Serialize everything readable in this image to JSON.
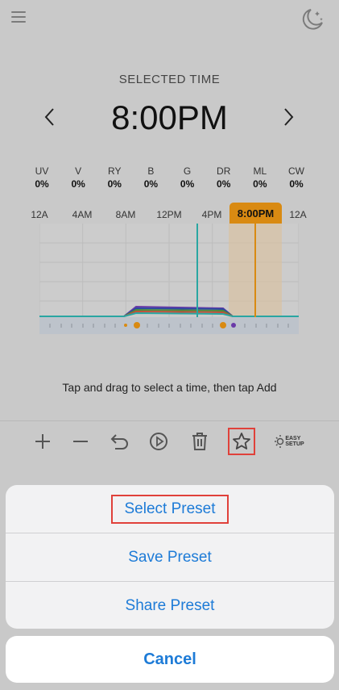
{
  "header": {
    "menu_icon": "hamburger-menu-icon",
    "moon_icon": "moon-stars-icon"
  },
  "schedule": {
    "selected_label": "SELECTED TIME",
    "time": "8:00PM",
    "prev_icon": "chevron-left-icon",
    "next_icon": "chevron-right-icon"
  },
  "channels": [
    {
      "name": "UV",
      "value": "0%"
    },
    {
      "name": "V",
      "value": "0%"
    },
    {
      "name": "RY",
      "value": "0%"
    },
    {
      "name": "B",
      "value": "0%"
    },
    {
      "name": "G",
      "value": "0%"
    },
    {
      "name": "DR",
      "value": "0%"
    },
    {
      "name": "ML",
      "value": "0%"
    },
    {
      "name": "CW",
      "value": "0%"
    }
  ],
  "timeline": {
    "labels": [
      "12A",
      "4AM",
      "8AM",
      "12PM",
      "4PM",
      "12A"
    ],
    "selected": "8:00PM"
  },
  "hint": "Tap and drag to select a time, then tap Add",
  "toolbar": {
    "icons": [
      "plus-icon",
      "minus-icon",
      "undo-icon",
      "play-icon",
      "trash-icon",
      "star-icon",
      "easy-setup-icon"
    ],
    "easy_setup_line1": "EASY",
    "easy_setup_line2": "SETUP"
  },
  "action_sheet": {
    "items": [
      "Select Preset",
      "Save Preset",
      "Share Preset"
    ],
    "cancel": "Cancel"
  },
  "colors": {
    "accent": "#d98a12",
    "link": "#1d7bd7",
    "highlight": "#e0413a",
    "teal": "#2aa6a2"
  }
}
